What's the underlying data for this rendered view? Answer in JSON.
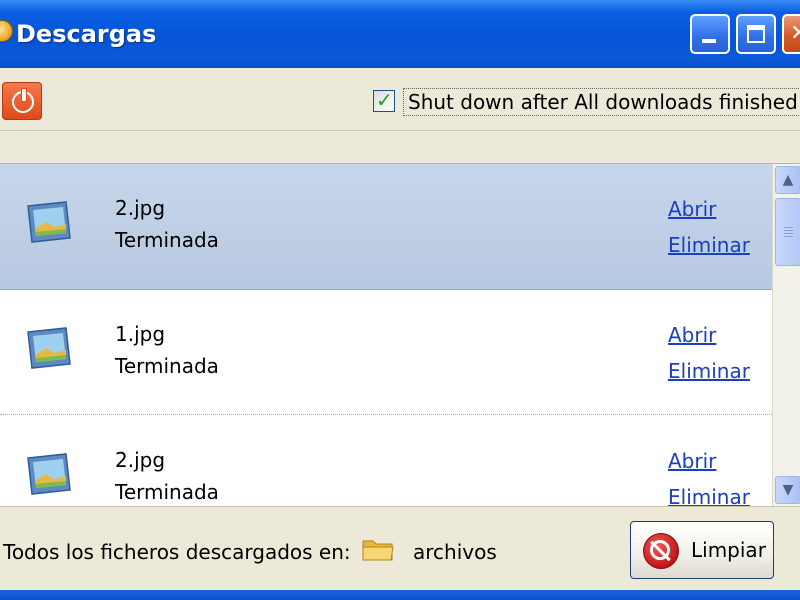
{
  "window": {
    "title": "Descargas",
    "icons": {
      "minimize": "minimize-icon",
      "maximize": "maximize-icon",
      "close": "close-icon"
    }
  },
  "toolbar": {
    "power_icon": "power-icon",
    "shutdown_checked": true,
    "shutdown_label": "Shut down after All downloads finished"
  },
  "downloads": [
    {
      "filename": "2.jpg",
      "status": "Terminada",
      "open_label": "Abrir",
      "remove_label": "Eliminar",
      "selected": true
    },
    {
      "filename": "1.jpg",
      "status": "Terminada",
      "open_label": "Abrir",
      "remove_label": "Eliminar",
      "selected": false
    },
    {
      "filename": "2.jpg",
      "status": "Terminada",
      "open_label": "Abrir",
      "remove_label": "Eliminar",
      "selected": false
    }
  ],
  "statusbar": {
    "all_files_label": "Todos los ficheros descargados en:",
    "folder_icon": "folder-icon",
    "folder_name": "archivos",
    "clear_label": "Limpiar"
  },
  "colors": {
    "titlebar": "#0554d8",
    "link": "#1a3fbf",
    "selected_row": "#c8d6ea",
    "window_bg": "#ece9d8"
  }
}
